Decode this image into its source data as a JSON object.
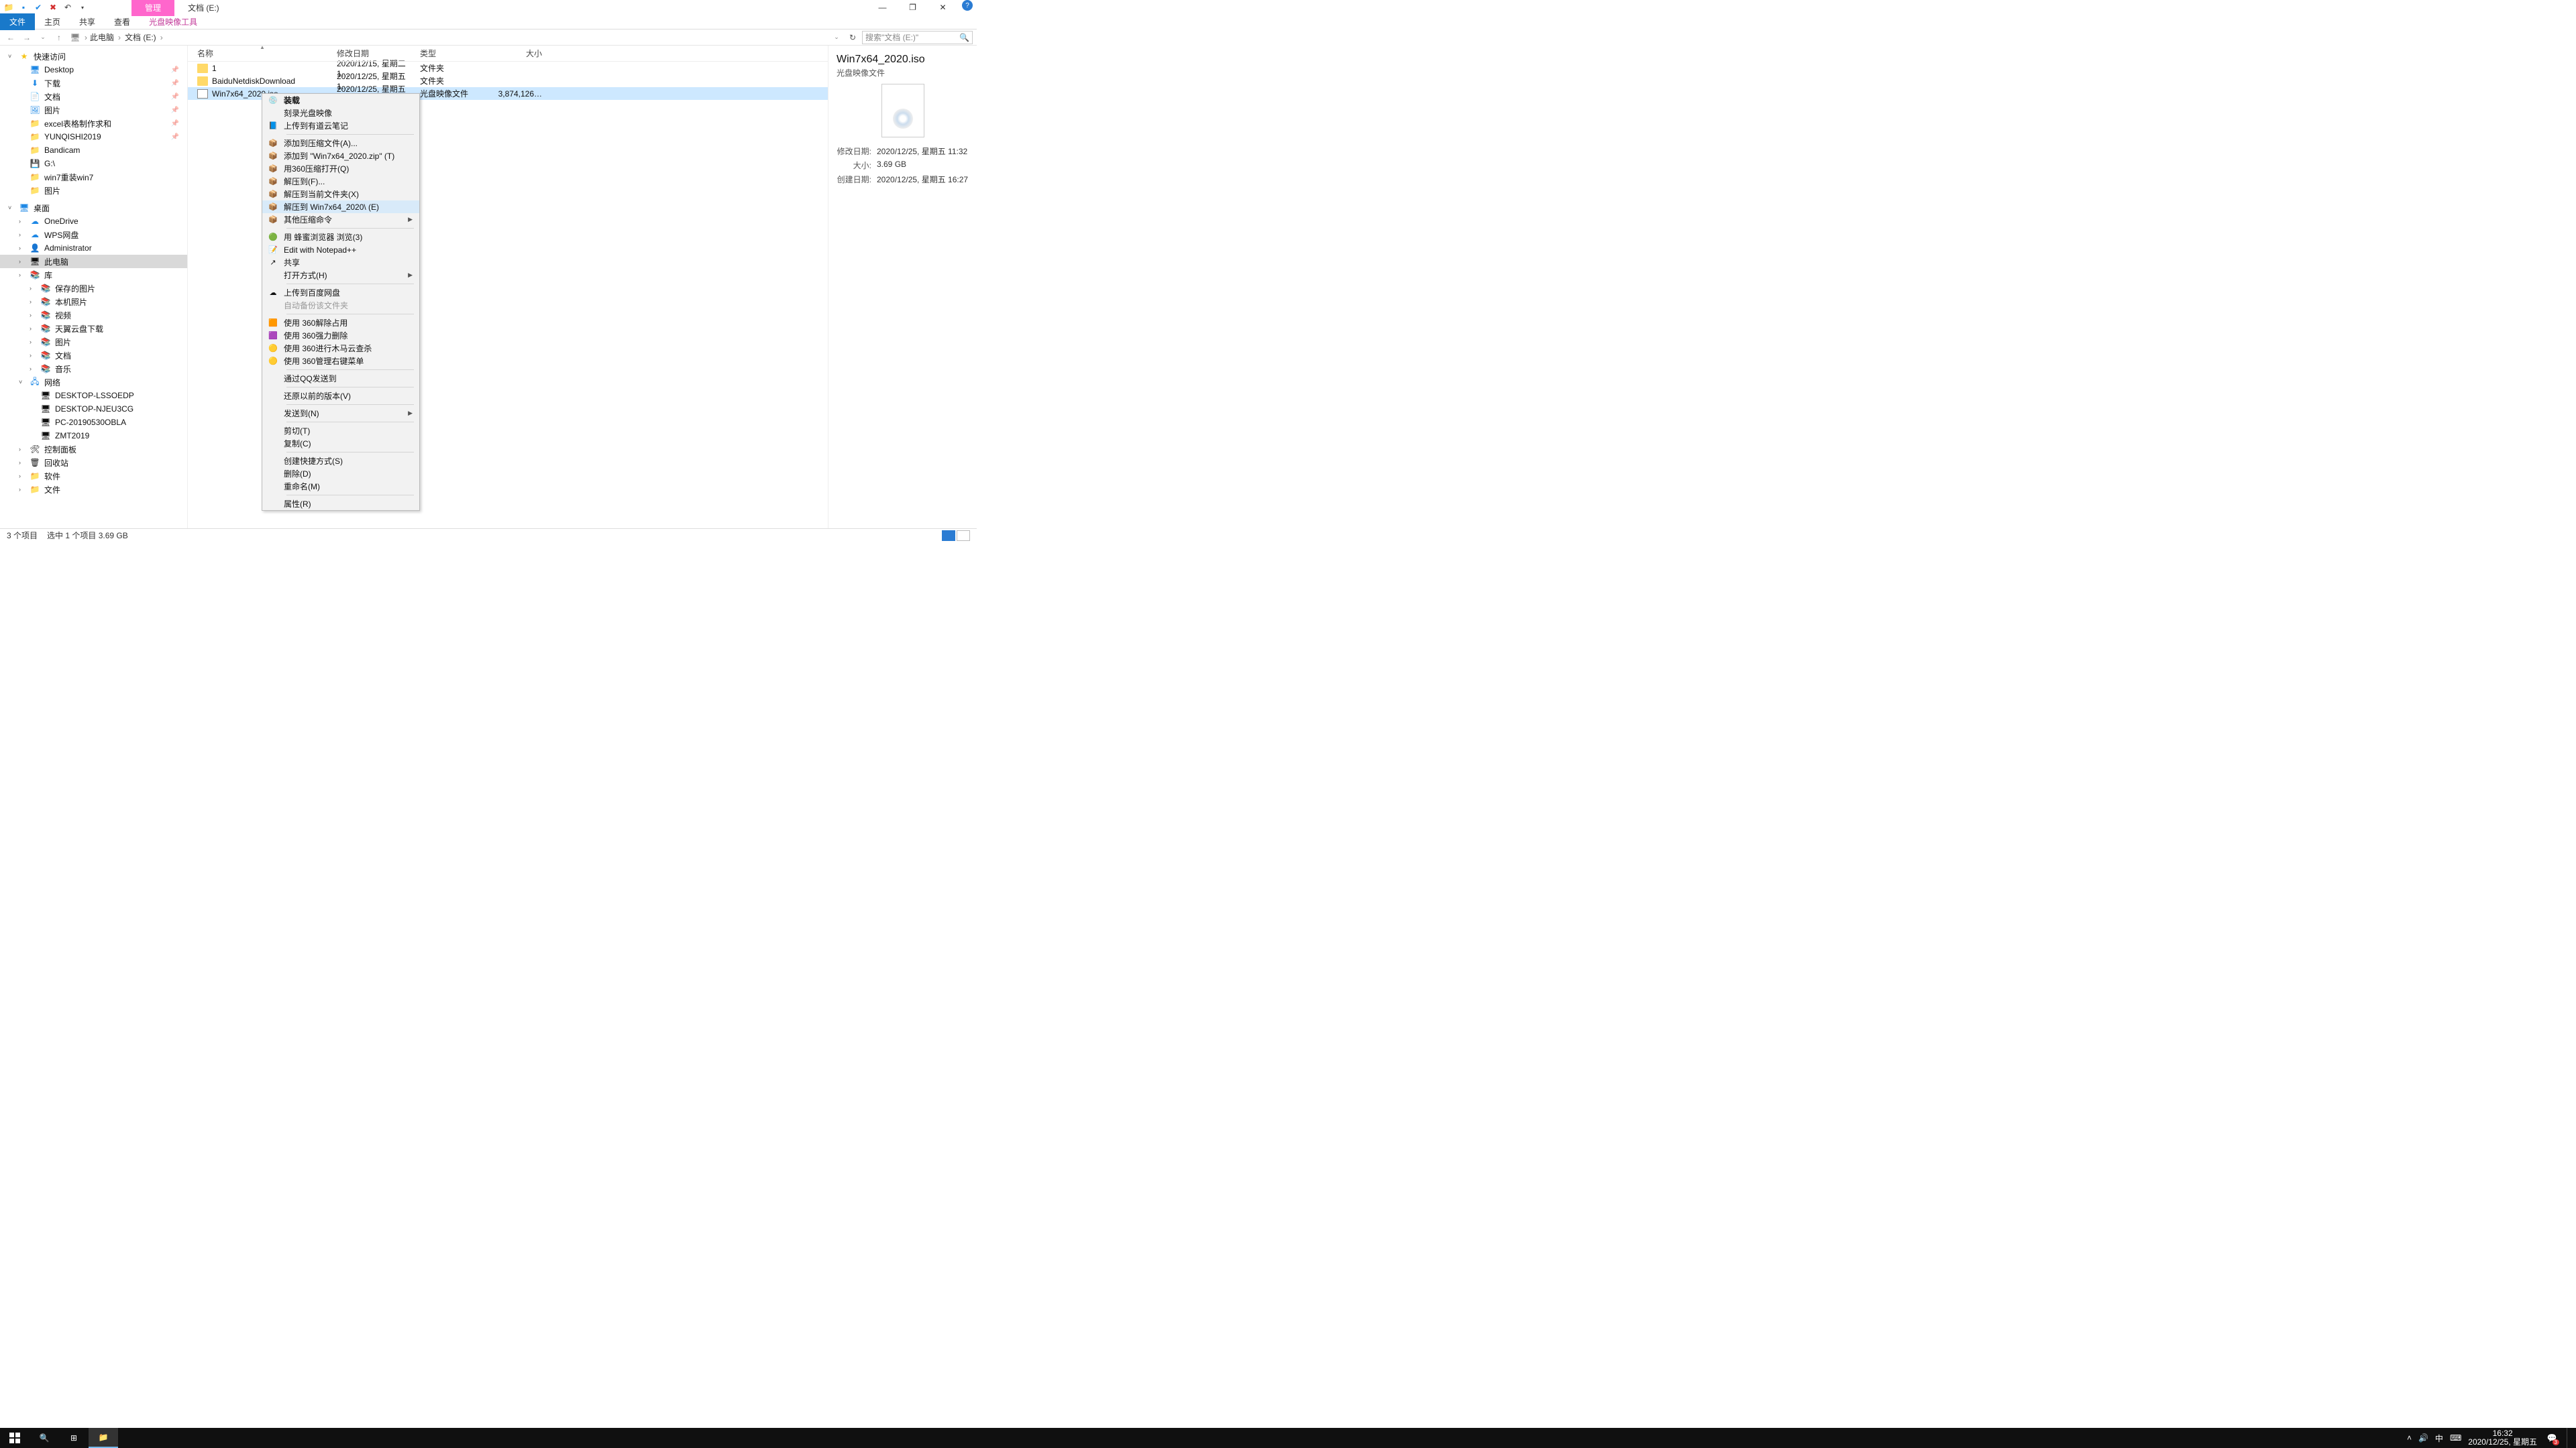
{
  "title_tabs": {
    "manage": "管理",
    "location": "文档 (E:)"
  },
  "window_buttons": {
    "min": "—",
    "max": "❐",
    "close": "✕"
  },
  "ribbon": {
    "file": "文件",
    "home": "主页",
    "share": "共享",
    "view": "查看",
    "tool": "光盘映像工具"
  },
  "address": {
    "back": "←",
    "fwd": "→",
    "up": "↑",
    "crumbs": [
      "此电脑",
      "文档 (E:)"
    ],
    "search_placeholder": "搜索\"文档 (E:)\"",
    "dropdown": "⌄",
    "refresh": "↻",
    "search_icon": "🔍"
  },
  "nav": {
    "quick": {
      "label": "快速访问",
      "items": [
        {
          "label": "Desktop",
          "icon": "🖥",
          "pinned": true
        },
        {
          "label": "下载",
          "icon": "⬇",
          "pinned": true
        },
        {
          "label": "文档",
          "icon": "📄",
          "pinned": true
        },
        {
          "label": "图片",
          "icon": "🖼",
          "pinned": true
        },
        {
          "label": "excel表格制作求和",
          "icon": "📁",
          "pinned": true
        },
        {
          "label": "YUNQISHI2019",
          "icon": "📁",
          "pinned": true
        },
        {
          "label": "Bandicam",
          "icon": "📁"
        },
        {
          "label": "G:\\",
          "icon": "💾"
        },
        {
          "label": "win7重装win7",
          "icon": "📁"
        },
        {
          "label": "图片",
          "icon": "📁"
        }
      ]
    },
    "desktop": {
      "label": "桌面",
      "items": [
        {
          "label": "OneDrive",
          "icon": "☁",
          "color": "ico-blue"
        },
        {
          "label": "WPS网盘",
          "icon": "☁",
          "color": "ico-blue"
        },
        {
          "label": "Administrator",
          "icon": "👤"
        },
        {
          "label": "此电脑",
          "icon": "🖥",
          "selected": true
        },
        {
          "label": "库",
          "icon": "📚"
        }
      ]
    },
    "libs": [
      {
        "label": "保存的图片"
      },
      {
        "label": "本机照片"
      },
      {
        "label": "视频"
      },
      {
        "label": "天翼云盘下载"
      },
      {
        "label": "图片"
      },
      {
        "label": "文档"
      },
      {
        "label": "音乐"
      }
    ],
    "network": {
      "label": "网络",
      "items": [
        {
          "label": "DESKTOP-LSSOEDP"
        },
        {
          "label": "DESKTOP-NJEU3CG"
        },
        {
          "label": "PC-20190530OBLA"
        },
        {
          "label": "ZMT2019"
        }
      ]
    },
    "others": [
      {
        "label": "控制面板",
        "icon": "🛠"
      },
      {
        "label": "回收站",
        "icon": "🗑"
      },
      {
        "label": "软件",
        "icon": "📁"
      },
      {
        "label": "文件",
        "icon": "📁"
      }
    ]
  },
  "columns": {
    "name": "名称",
    "modified": "修改日期",
    "type": "类型",
    "size": "大小"
  },
  "rows": [
    {
      "name": "1",
      "type_icon": "folder",
      "modified": "2020/12/15, 星期二 1…",
      "type": "文件夹",
      "size": ""
    },
    {
      "name": "BaiduNetdiskDownload",
      "type_icon": "folder",
      "modified": "2020/12/25, 星期五 1…",
      "type": "文件夹",
      "size": ""
    },
    {
      "name": "Win7x64_2020.iso",
      "type_icon": "iso",
      "modified": "2020/12/25, 星期五 1…",
      "type": "光盘映像文件",
      "size": "3,874,126…",
      "selected": true
    }
  ],
  "details": {
    "title": "Win7x64_2020.iso",
    "subtitle": "光盘映像文件",
    "modified_k": "修改日期:",
    "modified_v": "2020/12/25, 星期五 11:32",
    "size_k": "大小:",
    "size_v": "3.69 GB",
    "created_k": "创建日期:",
    "created_v": "2020/12/25, 星期五 16:27"
  },
  "context_menu": {
    "groups": [
      [
        {
          "label": "装载",
          "bold": true,
          "icon": "💿"
        },
        {
          "label": "刻录光盘映像"
        },
        {
          "label": "上传到有道云笔记",
          "icon": "📘"
        }
      ],
      [
        {
          "label": "添加到压缩文件(A)...",
          "icon": "📦"
        },
        {
          "label": "添加到 \"Win7x64_2020.zip\" (T)",
          "icon": "📦"
        },
        {
          "label": "用360压缩打开(Q)",
          "icon": "📦"
        },
        {
          "label": "解压到(F)...",
          "icon": "📦"
        },
        {
          "label": "解压到当前文件夹(X)",
          "icon": "📦"
        },
        {
          "label": "解压到 Win7x64_2020\\ (E)",
          "icon": "📦",
          "highlighted": true
        },
        {
          "label": "其他压缩命令",
          "icon": "📦",
          "submenu": true
        }
      ],
      [
        {
          "label": "用 蜂蜜浏览器 浏览(3)",
          "icon": "🟢"
        },
        {
          "label": "Edit with Notepad++",
          "icon": "📝"
        },
        {
          "label": "共享",
          "icon": "↗"
        },
        {
          "label": "打开方式(H)",
          "submenu": true
        }
      ],
      [
        {
          "label": "上传到百度网盘",
          "icon": "☁"
        },
        {
          "label": "自动备份该文件夹",
          "disabled": true
        }
      ],
      [
        {
          "label": "使用 360解除占用",
          "icon": "🟧"
        },
        {
          "label": "使用 360强力删除",
          "icon": "🟪"
        },
        {
          "label": "使用 360进行木马云查杀",
          "icon": "🟡"
        },
        {
          "label": "使用 360管理右键菜单",
          "icon": "🟡"
        }
      ],
      [
        {
          "label": "通过QQ发送到"
        }
      ],
      [
        {
          "label": "还原以前的版本(V)"
        }
      ],
      [
        {
          "label": "发送到(N)",
          "submenu": true
        }
      ],
      [
        {
          "label": "剪切(T)"
        },
        {
          "label": "复制(C)"
        }
      ],
      [
        {
          "label": "创建快捷方式(S)"
        },
        {
          "label": "删除(D)"
        },
        {
          "label": "重命名(M)"
        }
      ],
      [
        {
          "label": "属性(R)"
        }
      ]
    ]
  },
  "status": {
    "count": "3 个项目",
    "selected": "选中 1 个项目  3.69 GB"
  },
  "tray": {
    "up": "˄",
    "vol": "🔊",
    "ime": "中",
    "keyb": "⌨",
    "time": "16:32",
    "date": "2020/12/25, 星期五",
    "notif_count": "3"
  }
}
